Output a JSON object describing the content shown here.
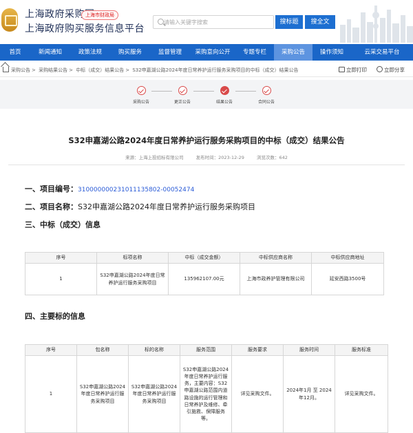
{
  "header": {
    "title_line1": "上海政府采购网",
    "title_line2": "上海政府购买服务信息平台",
    "tag": "上海市财政局",
    "search_placeholder": "请输入关键字搜索",
    "btn_search_title": "搜标题",
    "btn_search_full": "搜全文"
  },
  "nav": [
    {
      "label": "首页"
    },
    {
      "label": "新闻通知"
    },
    {
      "label": "政策法规"
    },
    {
      "label": "购买服务"
    },
    {
      "label": "监督管理"
    },
    {
      "label": "采购意向公开"
    },
    {
      "label": "专题专栏"
    },
    {
      "label": "采购公告"
    },
    {
      "label": "操作须知"
    },
    {
      "label": "云采交易平台"
    }
  ],
  "breadcrumb": [
    "采购公告",
    "采购结果公告",
    "中标（成交）结果公告",
    "S32申嘉湖公路2024年度日常养护运行服务采购项目的中标（成交）结果公告"
  ],
  "tools": {
    "print": "立即打印",
    "share": "立即分享"
  },
  "steps": [
    {
      "label": "采购公告"
    },
    {
      "label": "更正公告"
    },
    {
      "label": "结果公告"
    },
    {
      "label": "合同公告"
    }
  ],
  "article": {
    "title": "S32申嘉湖公路2024年度日常养护运行服务采购项目的中标（成交）结果公告",
    "source": "来源：上海上投招标有限公司",
    "published": "发布时间：2023-12-29",
    "views": "浏览次数：642",
    "sec1_label": "一、项目编号：",
    "sec1_value": "310000000231011135802-00052474",
    "sec2_label": "二、项目名称：",
    "sec2_value": "S32申嘉湖公路2024年度日常养护运行服务采购项目",
    "sec3_label": "三、中标（成交）信息",
    "sec4_label": "四、主要标的信息"
  },
  "award_table": {
    "headers": [
      "序号",
      "标项名称",
      "中标（成交金额）",
      "中标供应商名称",
      "中标供应商地址"
    ],
    "row": [
      "1",
      "S32申嘉湖公路2024年度日常养护运行服务采购项目",
      "135962107.00元",
      "上海市政养护管理有限公司",
      "延安西路3500号"
    ]
  },
  "subject_table": {
    "headers": [
      "序号",
      "包名称",
      "标的名称",
      "服务范围",
      "服务要求",
      "服务时间",
      "服务标准"
    ],
    "row": [
      "1",
      "S32申嘉湖公路2024年度日常养护运行服务采购项目",
      "S32申嘉湖公路2024年度日常养护运行服务采购项目",
      "S32申嘉湖公路2024年度日常养护运行服务，主要内容：S32申嘉湖公路范围内道路设施的运行管理和日常养护及维修、牵引施救、保障服务等。",
      "详见采购文件。",
      "2024年1月 至 2024年12月。",
      "详见采购文件。"
    ]
  },
  "colors": {
    "nav_blue": "#1a66c8",
    "nav_active": "#5d94e0",
    "step_red": "#d94a4a",
    "link_blue": "#2a5bd7"
  }
}
